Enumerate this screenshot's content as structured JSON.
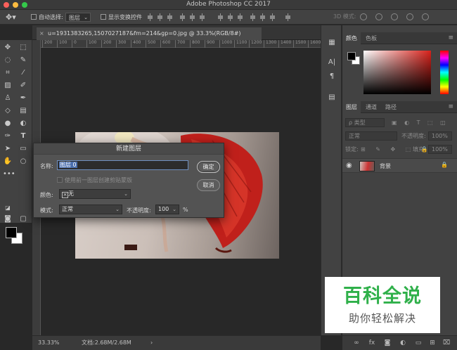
{
  "window": {
    "title": "Adobe Photoshop CC 2017"
  },
  "options_bar": {
    "auto_select_label": "自动选择:",
    "auto_select_value": "图层",
    "show_transform_label": "显示变换控件",
    "mode_3d_label": "3D 模式:"
  },
  "document": {
    "tab_title": "u=1931383265,1507027187&fm=214&gp=0.jpg @ 33.3%(RGB/8#)",
    "zoom": "33.33%",
    "doc_info": "文档:2.68M/2.68M"
  },
  "ruler": {
    "ticks": [
      "200",
      "100",
      "0",
      "100",
      "200",
      "300",
      "400",
      "500",
      "600",
      "700",
      "800",
      "900",
      "1000",
      "1100",
      "1200",
      "1300",
      "1400",
      "1500",
      "1600"
    ]
  },
  "dialog": {
    "title": "新建图层",
    "name_label": "名称:",
    "name_value": "图层 0",
    "clip_label": "使用前一图层创建剪贴蒙版",
    "color_label": "颜色:",
    "color_value": "无",
    "mode_label": "模式:",
    "mode_value": "正常",
    "opacity_label": "不透明度:",
    "opacity_value": "100",
    "opacity_unit": "%",
    "ok_label": "确定",
    "cancel_label": "取消"
  },
  "color_panel": {
    "tabs": [
      "颜色",
      "色板"
    ]
  },
  "layers_panel": {
    "tabs": [
      "图层",
      "通道",
      "路径"
    ],
    "filter_label": "ρ 类型",
    "blend_mode": "正常",
    "opacity_label": "不透明度:",
    "opacity_value": "100%",
    "lock_label": "锁定:",
    "fill_label": "填充:",
    "fill_value": "100%",
    "layer_name": "背景"
  },
  "watermark": {
    "title": "百科全说",
    "subtitle": "助你轻松解决"
  }
}
